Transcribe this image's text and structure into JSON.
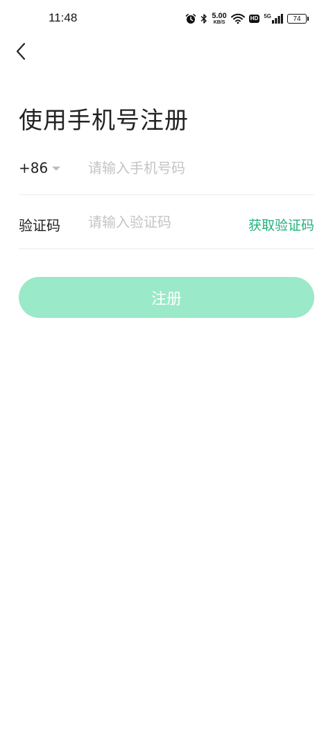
{
  "status_bar": {
    "time": "11:48",
    "net_speed_value": "5.00",
    "net_speed_unit": "KB/S",
    "hd_label": "HD",
    "signal_label": "5G",
    "battery_level": "74",
    "icons": [
      "alarm-icon",
      "bluetooth-icon",
      "wifi-icon",
      "signal-icon",
      "battery-icon"
    ]
  },
  "header": {
    "back_icon": "chevron-left-icon"
  },
  "page": {
    "title": "使用手机号注册"
  },
  "form": {
    "country_code": "+86",
    "phone_placeholder": "请输入手机号码",
    "phone_value": "",
    "code_label": "验证码",
    "code_placeholder": "请输入验证码",
    "code_value": "",
    "get_code_label": "获取验证码",
    "submit_label": "注册"
  },
  "colors": {
    "accent": "#22b07a",
    "button_disabled": "#9ae9c8",
    "placeholder": "#c4c4c4",
    "divider": "#ececec"
  }
}
